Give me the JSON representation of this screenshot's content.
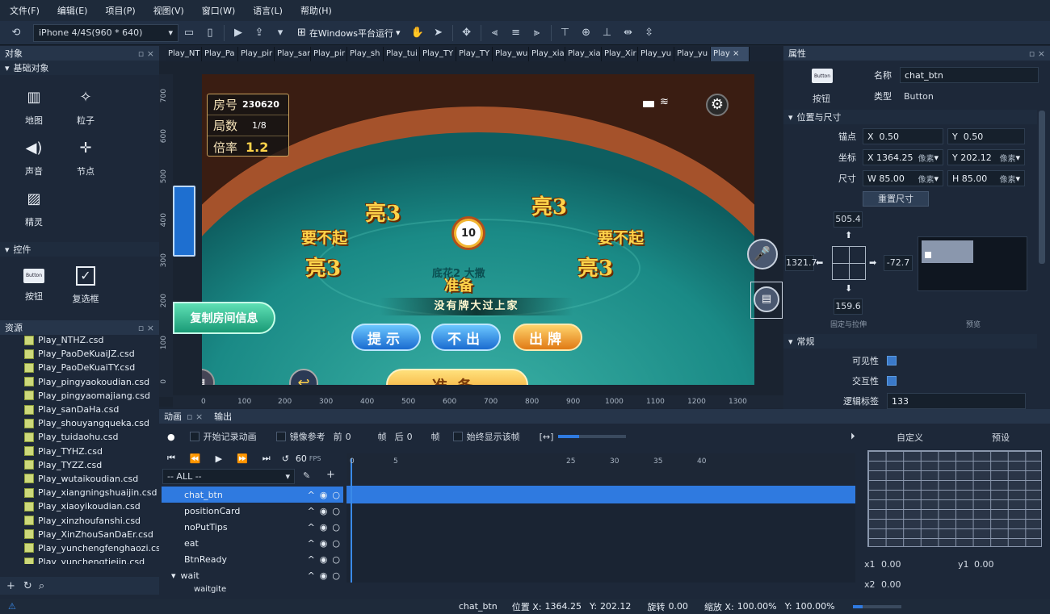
{
  "menu": [
    "文件(F)",
    "编辑(E)",
    "项目(P)",
    "视图(V)",
    "窗口(W)",
    "语言(L)",
    "帮助(H)"
  ],
  "toolbar": {
    "device": "iPhone 4/4S(960 * 640)",
    "run_label": "在Windows平台运行"
  },
  "objects_panel": {
    "title": "对象",
    "sections": [
      {
        "title": "基础对象",
        "items": [
          {
            "label": "地图",
            "icon": "map-icon"
          },
          {
            "label": "粒子",
            "icon": "particles-icon"
          },
          {
            "label": "声音",
            "icon": "sound-icon"
          },
          {
            "label": "节点",
            "icon": "node-icon"
          },
          {
            "label": "精灵",
            "icon": "sprite-icon"
          }
        ]
      },
      {
        "title": "控件",
        "items": [
          {
            "label": "按钮",
            "icon": "button-icon",
            "icon_text": "Button"
          },
          {
            "label": "复选框",
            "icon": "checkbox-icon"
          }
        ]
      }
    ]
  },
  "resources_panel": {
    "title": "资源",
    "files": [
      "Play_NTHZ.csd",
      "Play_PaoDeKuaiJZ.csd",
      "Play_PaoDeKuaiTY.csd",
      "Play_pingyaokoudian.csd",
      "Play_pingyaomajiang.csd",
      "Play_sanDaHa.csd",
      "Play_shouyangqueka.csd",
      "Play_tuidaohu.csd",
      "Play_TYHZ.csd",
      "Play_TYZZ.csd",
      "Play_wutaikoudian.csd",
      "Play_xiangningshuaijin.csd",
      "Play_xiaoyikoudian.csd",
      "Play_xinzhoufanshi.csd",
      "Play_XinZhouSanDaEr.csd",
      "Play_yunchengfenghaozi.csd",
      "Play_yunchengtiejin.csd"
    ]
  },
  "doc_tabs": [
    "Play_NT",
    "Play_Pa",
    "Play_pir",
    "Play_sar",
    "Play_pir",
    "Play_sh",
    "Play_tui",
    "Play_TY",
    "Play_TY",
    "Play_wu",
    "Play_xia",
    "Play_xia",
    "Play_Xir",
    "Play_yu",
    "Play_yu",
    "Play"
  ],
  "ruler": {
    "v": [
      "700",
      "600",
      "500",
      "400",
      "300",
      "200",
      "100",
      "0"
    ],
    "h": [
      "0",
      "100",
      "200",
      "300",
      "400",
      "500",
      "600",
      "700",
      "800",
      "900",
      "1000",
      "1100",
      "1200",
      "1300"
    ]
  },
  "game": {
    "room_label": "房号",
    "room_value": "230620",
    "round_label": "局数",
    "round_value": "1/8",
    "rate_label": "倍率",
    "rate_value": "1.2",
    "timer": "10",
    "calls": [
      "亮3",
      "亮3",
      "亮3",
      "亮3"
    ],
    "pass_left": "要不起",
    "pass_right": "要不起",
    "center_info": "底花2 大撒",
    "ready_title": "准备",
    "no_bigger": "没有牌大过上家",
    "copy_room": "复制房间信息",
    "hint_btn": "提示",
    "pass_btn": "不出",
    "play_btn": "出牌",
    "ready_btn": "准备"
  },
  "properties": {
    "title": "属性",
    "button_icon_text": "Button",
    "type_caption": "按钮",
    "name_label": "名称",
    "name_value": "chat_btn",
    "type_label": "类型",
    "type_value": "Button",
    "pos_size_title": "位置与尺寸",
    "anchor_label": "锚点",
    "anchor_x": "0.50",
    "anchor_y": "0.50",
    "coord_label": "坐标",
    "coord_x": "1364.25",
    "coord_y": "202.12",
    "size_label": "尺寸",
    "size_w": "85.00",
    "size_h": "85.00",
    "unit": "像素",
    "reset_size": "重置尺寸",
    "margins": {
      "top": "505.4",
      "left": "1321.7",
      "right": "-72.7",
      "bottom": "159.6"
    },
    "fixed_label": "固定与拉伸",
    "preview_label": "预览",
    "general_title": "常规",
    "visible_label": "可见性",
    "interactive_label": "交互性",
    "tag_label": "逻辑标签",
    "tag_value": "133"
  },
  "animation": {
    "tab_anim": "动画",
    "tab_output": "输出",
    "record_label": "开始记录动画",
    "mirror_label": "镜像参考",
    "prev_label": "前",
    "prev_value": "0",
    "frame_label": "帧",
    "next_label": "后",
    "next_value": "0",
    "always_show": "始终显示该帧",
    "fps_value": "60",
    "fps_unit": "FPS",
    "filter": "-- ALL --",
    "timeline_marks": [
      "0",
      "5",
      "25",
      "30",
      "35",
      "40"
    ],
    "layers": [
      "chat_btn",
      "positionCard",
      "noPutTips",
      "eat",
      "BtnReady",
      "wait",
      "waitgite"
    ],
    "curve_tab_custom": "自定义",
    "curve_tab_preset": "预设",
    "x1": "0.00",
    "y1": "0.00",
    "x2": "0.00"
  },
  "status": {
    "name": "chat_btn",
    "pos_label": "位置 X:",
    "pos_x": "1364.25",
    "pos_y_label": "Y:",
    "pos_y": "202.12",
    "rot_label": "旋转",
    "rot": "0.00",
    "scale_label": "缩放 X:",
    "scale_x": "100.00%",
    "scale_y_label": "Y:",
    "scale_y": "100.00%"
  },
  "colors": {
    "accent": "#2f7ae0",
    "panel": "#1d2839",
    "table_felt": "#1d8a86"
  }
}
